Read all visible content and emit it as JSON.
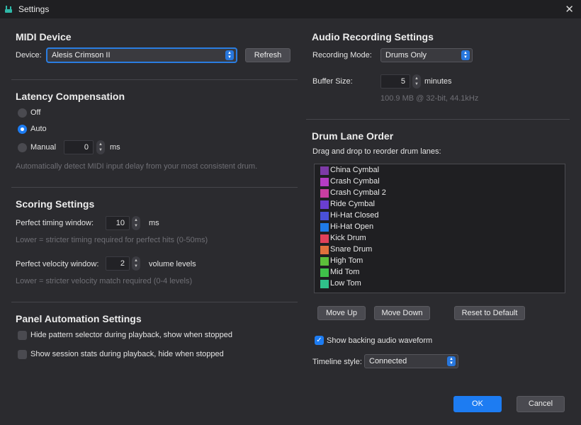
{
  "window": {
    "title": "Settings"
  },
  "midi": {
    "heading": "MIDI Device",
    "device_label": "Device:",
    "device_value": "Alesis Crimson II",
    "refresh_label": "Refresh"
  },
  "latency": {
    "heading": "Latency Compensation",
    "options": [
      "Off",
      "Auto",
      "Manual"
    ],
    "selected": "Auto",
    "manual_value": "0",
    "manual_unit": "ms",
    "hint": "Automatically detect MIDI input delay from your most consistent drum."
  },
  "scoring": {
    "heading": "Scoring Settings",
    "timing_label": "Perfect timing window:",
    "timing_value": "10",
    "timing_unit": "ms",
    "timing_hint": "Lower = stricter timing required for perfect hits (0-50ms)",
    "velocity_label": "Perfect velocity window:",
    "velocity_value": "2",
    "velocity_unit": "volume levels",
    "velocity_hint": "Lower = stricter velocity match required (0-4 levels)"
  },
  "panel": {
    "heading": "Panel Automation Settings",
    "opt1": "Hide pattern selector during playback, show when stopped",
    "opt2": "Show session stats during playback, hide when stopped",
    "opt1_checked": false,
    "opt2_checked": false
  },
  "audio": {
    "heading": "Audio Recording Settings",
    "mode_label": "Recording Mode:",
    "mode_value": "Drums Only",
    "buffer_label": "Buffer Size:",
    "buffer_value": "5",
    "buffer_unit": "minutes",
    "buffer_info": "100.9 MB @ 32-bit, 44.1kHz"
  },
  "lanes": {
    "heading": "Drum Lane Order",
    "subtitle": "Drag and drop to reorder drum lanes:",
    "items": [
      {
        "name": "China Cymbal",
        "color": "#7d3aa6"
      },
      {
        "name": "Crash Cymbal",
        "color": "#b63cc4"
      },
      {
        "name": "Crash Cymbal 2",
        "color": "#c93ea0"
      },
      {
        "name": "Ride Cymbal",
        "color": "#6a3ed0"
      },
      {
        "name": "Hi-Hat Closed",
        "color": "#4a50d8"
      },
      {
        "name": "Hi-Hat Open",
        "color": "#1f7ae6"
      },
      {
        "name": "Kick Drum",
        "color": "#e0405a"
      },
      {
        "name": "Snare Drum",
        "color": "#e0703c"
      },
      {
        "name": "High Tom",
        "color": "#5cbf3a"
      },
      {
        "name": "Mid Tom",
        "color": "#3fc24a"
      },
      {
        "name": "Low Tom",
        "color": "#2fc08a"
      }
    ],
    "move_up": "Move Up",
    "move_down": "Move Down",
    "reset": "Reset to Default",
    "waveform_label": "Show backing audio waveform",
    "waveform_checked": true,
    "timeline_label": "Timeline style:",
    "timeline_value": "Connected"
  },
  "footer": {
    "ok": "OK",
    "cancel": "Cancel"
  }
}
